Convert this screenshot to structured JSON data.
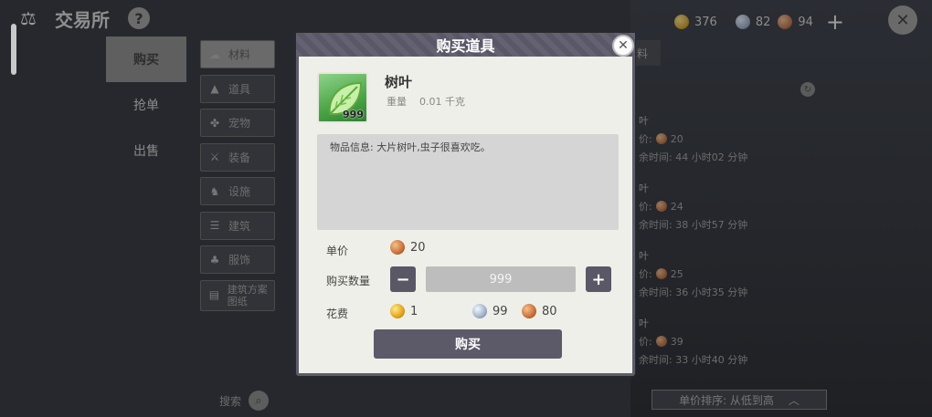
{
  "header": {
    "title": "交易所",
    "help": "?"
  },
  "currency": [
    {
      "kind": "gold",
      "icon": "gold-coin-icon",
      "value": "376"
    },
    {
      "kind": "silver",
      "icon": "silver-coin-icon",
      "value": "82"
    },
    {
      "kind": "bronze",
      "icon": "bronze-coin-icon",
      "value": "94"
    }
  ],
  "nav": {
    "buy": "购买",
    "grab": "抢单",
    "sell": "出售"
  },
  "categories": [
    "材料",
    "道具",
    "宠物",
    "装备",
    "设施",
    "建筑",
    "服饰",
    "建筑方案图纸"
  ],
  "search_label": "搜索",
  "tab_fragment": "料",
  "listings": [
    {
      "name": "叶",
      "price": "20",
      "time": "余时间: 44 小时02 分钟"
    },
    {
      "name": "叶",
      "price": "24",
      "time": "余时间: 38 小时57 分钟"
    },
    {
      "name": "叶",
      "price": "25",
      "time": "余时间: 36 小时35 分钟"
    },
    {
      "name": "叶",
      "price": "39",
      "time": "余时间: 33 小时40 分钟"
    }
  ],
  "sort_label": "单价排序: 从低到高",
  "modal": {
    "title": "购买道具",
    "item_name": "树叶",
    "item_qty": "999",
    "weight_label": "重量",
    "weight_value": "0.01 千克",
    "description": "物品信息: 大片树叶,虫子很喜欢吃。",
    "unit_price_label": "单价",
    "unit_price": "20",
    "quantity_label": "购买数量",
    "quantity_value": "999",
    "cost_label": "花费",
    "cost_gold": "1",
    "cost_silver": "99",
    "cost_bronze": "80",
    "buy_button": "购买"
  }
}
